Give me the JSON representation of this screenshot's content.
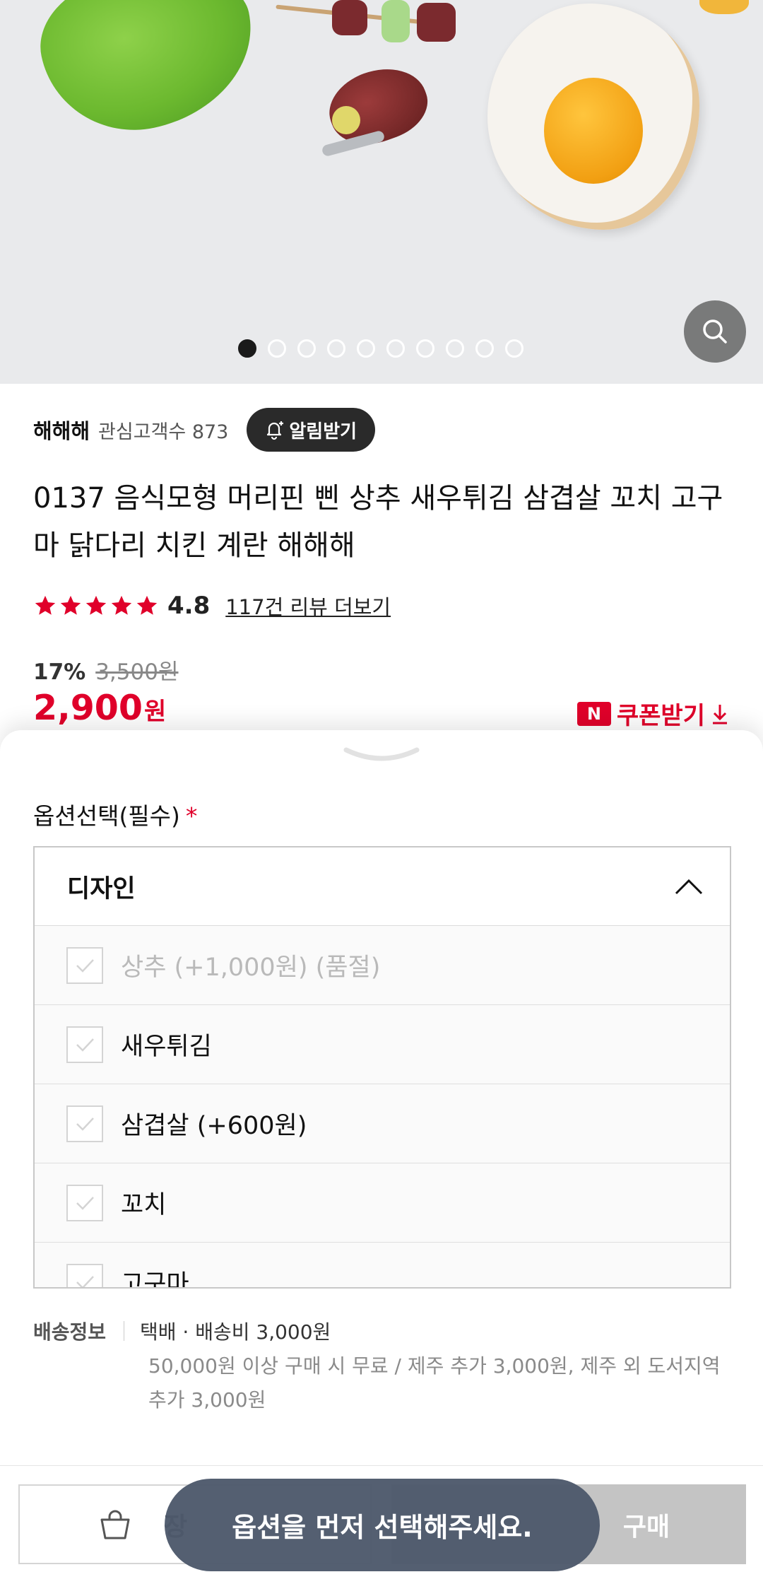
{
  "gallery": {
    "dot_count": 10,
    "active_index": 0
  },
  "store": {
    "name": "해해해",
    "followers": "관심고객수 873",
    "follow_button": "알림받기"
  },
  "product": {
    "title": "0137 음식모형 머리핀 삔 상추 새우튀김 삼겹살 꼬치 고구마 닭다리 치킨 계란 해해해",
    "rating": "4.8",
    "rating_stars": 5,
    "review_link": "117건 리뷰 더보기",
    "discount_rate": "17%",
    "original_price": "3,500원",
    "price": "2,900",
    "price_unit": "원"
  },
  "coupon": {
    "badge": "N",
    "label": "쿠폰받기"
  },
  "option_sheet": {
    "section_label": "옵션선택(필수)",
    "required_mark": "*",
    "dropdown_label": "디자인",
    "options": [
      {
        "label": "상추 (+1,000원) (품절)",
        "soldout": true
      },
      {
        "label": "새우튀김",
        "soldout": false
      },
      {
        "label": "삼겹살 (+600원)",
        "soldout": false
      },
      {
        "label": "꼬치",
        "soldout": false
      },
      {
        "label": "고구마",
        "soldout": false
      }
    ]
  },
  "shipping": {
    "label": "배송정보",
    "main": "택배 · 배송비 3,000원",
    "sub": "50,000원 이상 구매 시 무료 / 제주 추가 3,000원, 제주 외 도서지역 추가 3,000원"
  },
  "actions": {
    "cart_label": "장",
    "buy_label": "구매"
  },
  "toast": {
    "message": "옵션을 먼저 선택해주세요."
  },
  "colors": {
    "accent_red": "#e0002a",
    "toast_bg": "#4e5a6c"
  }
}
